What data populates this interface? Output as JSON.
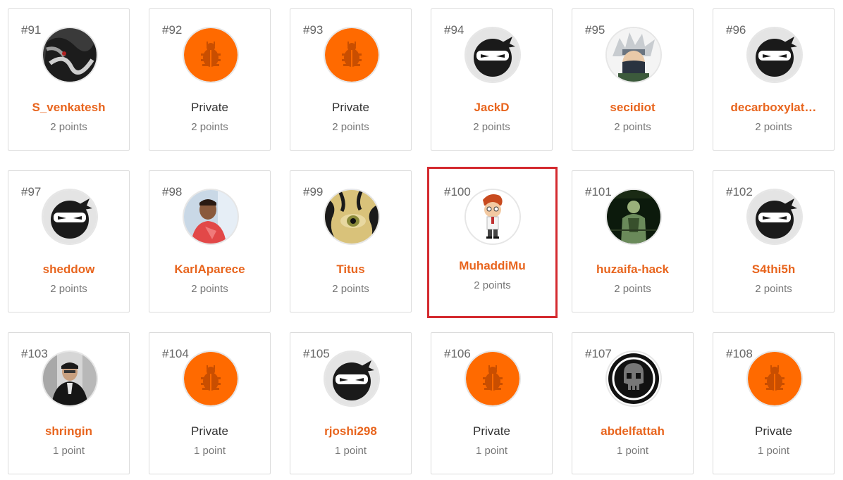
{
  "colors": {
    "accent": "#e8651e",
    "avatar_orange": "#ff6a00",
    "highlight_border": "#d42a2f",
    "card_border": "#dcdcdc"
  },
  "cards": [
    {
      "rank": "#91",
      "name": "S_venkatesh",
      "points": "2 points",
      "avatar": "photo-avatar",
      "private": false
    },
    {
      "rank": "#92",
      "name": "Private",
      "points": "2 points",
      "avatar": "bug-icon",
      "private": true
    },
    {
      "rank": "#93",
      "name": "Private",
      "points": "2 points",
      "avatar": "bug-icon",
      "private": true
    },
    {
      "rank": "#94",
      "name": "JackD",
      "points": "2 points",
      "avatar": "ninja-icon",
      "private": false
    },
    {
      "rank": "#95",
      "name": "secidiot",
      "points": "2 points",
      "avatar": "photo-avatar",
      "private": false
    },
    {
      "rank": "#96",
      "name": "decarboxylat…",
      "points": "2 points",
      "avatar": "ninja-icon",
      "private": false
    },
    {
      "rank": "#97",
      "name": "sheddow",
      "points": "2 points",
      "avatar": "ninja-icon",
      "private": false
    },
    {
      "rank": "#98",
      "name": "KarlAparece",
      "points": "2 points",
      "avatar": "photo-avatar",
      "private": false
    },
    {
      "rank": "#99",
      "name": "Titus",
      "points": "2 points",
      "avatar": "photo-avatar",
      "private": false
    },
    {
      "rank": "#100",
      "name": "MuhaddiMu",
      "points": "2 points",
      "avatar": "cartoon-avatar",
      "private": false,
      "highlighted": true
    },
    {
      "rank": "#101",
      "name": "huzaifa-hack",
      "points": "2 points",
      "avatar": "photo-avatar",
      "private": false
    },
    {
      "rank": "#102",
      "name": "S4thi5h",
      "points": "2 points",
      "avatar": "ninja-icon",
      "private": false
    },
    {
      "rank": "#103",
      "name": "shringin",
      "points": "1 point",
      "avatar": "photo-avatar",
      "private": false
    },
    {
      "rank": "#104",
      "name": "Private",
      "points": "1 point",
      "avatar": "bug-icon",
      "private": true
    },
    {
      "rank": "#105",
      "name": "rjoshi298",
      "points": "1 point",
      "avatar": "ninja-icon",
      "private": false
    },
    {
      "rank": "#106",
      "name": "Private",
      "points": "1 point",
      "avatar": "bug-icon",
      "private": true
    },
    {
      "rank": "#107",
      "name": "abdelfattah",
      "points": "1 point",
      "avatar": "skull-icon",
      "private": false
    },
    {
      "rank": "#108",
      "name": "Private",
      "points": "1 point",
      "avatar": "bug-icon",
      "private": true
    }
  ]
}
